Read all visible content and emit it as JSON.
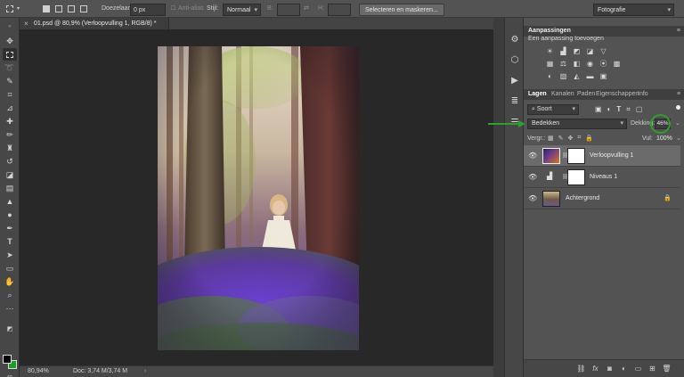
{
  "options_bar": {
    "feather_label": "Doezelaar:",
    "feather_value": "0 px",
    "antialias_label": "Anti-alias",
    "style_label": "Stijl:",
    "style_value": "Normaal",
    "width_label": "B:",
    "height_label": "H:",
    "select_mask_button": "Selecteren en maskeren...",
    "workspace_value": "Fotografie"
  },
  "document": {
    "tab_title": "01.psd @ 80,9% (Verloopvulling 1, RGB/8) *",
    "zoom": "80,94%",
    "doc_info": "Doc: 3,74 M/3,74 M"
  },
  "adjustments": {
    "title": "Aanpassingen",
    "subtitle": "Een aanpassing toevoegen",
    "row1": [
      "brightness-icon",
      "levels-icon",
      "curves-icon",
      "exposure-icon",
      "vibrance-icon"
    ],
    "row2": [
      "hue-saturation-icon",
      "color-balance-icon",
      "black-white-icon",
      "photo-filter-icon",
      "channel-mixer-icon",
      "color-lookup-icon"
    ],
    "row3": [
      "invert-icon",
      "posterize-icon",
      "threshold-icon",
      "gradient-map-icon",
      "selective-color-icon"
    ]
  },
  "layers_panel": {
    "tabs": [
      "Lagen",
      "Kanalen",
      "Paden",
      "Eigenschappen",
      "Info"
    ],
    "active_tab": "Lagen",
    "filter_kind": "Soort",
    "blend_mode": "Bedekken",
    "opacity_label": "Dekking:",
    "opacity_value": "46%",
    "lock_label": "Vergr.:",
    "fill_label": "Vul:",
    "fill_value": "100%",
    "layers": [
      {
        "name": "Verloopvulling 1",
        "kind": "gradient-fill",
        "selected": true
      },
      {
        "name": "Niveaus 1",
        "kind": "levels",
        "selected": false
      },
      {
        "name": "Achtergrond",
        "kind": "image",
        "selected": false,
        "locked": true
      }
    ]
  },
  "colors": {
    "foreground": "#000000",
    "background": "#1a9d2a",
    "annotation": "#2e9f2e"
  }
}
